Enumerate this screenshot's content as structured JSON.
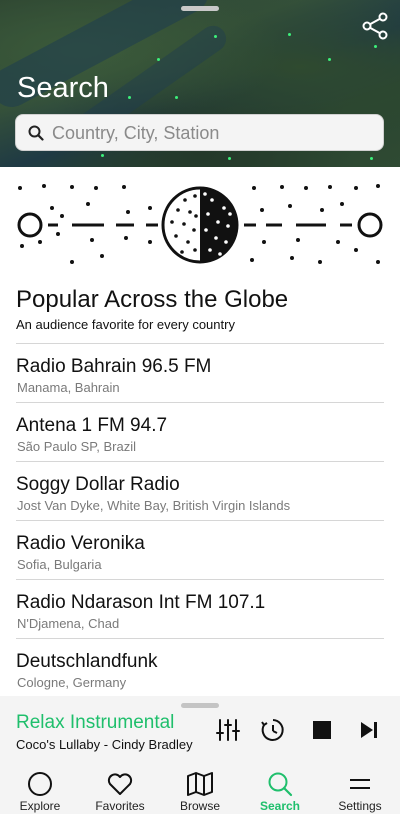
{
  "header": {
    "title": "Search",
    "search_placeholder": "Country, City, Station"
  },
  "section": {
    "title": "Popular Across the Globe",
    "subtitle": "An audience favorite for every country"
  },
  "stations": [
    {
      "name": "Radio Bahrain 96.5 FM",
      "location": "Manama, Bahrain"
    },
    {
      "name": "Antena 1 FM 94.7",
      "location": "São Paulo SP, Brazil"
    },
    {
      "name": "Soggy Dollar Radio",
      "location": "Jost Van Dyke, White Bay, British Virgin Islands"
    },
    {
      "name": "Radio Veronika",
      "location": "Sofia, Bulgaria"
    },
    {
      "name": "Radio Ndarason Int FM 107.1",
      "location": "N'Djamena, Chad"
    },
    {
      "name": "Deutschlandfunk",
      "location": "Cologne, Germany"
    }
  ],
  "player": {
    "title": "Relax Instrumental",
    "subtitle": "Coco's Lullaby - Cindy Bradley"
  },
  "tabs": [
    {
      "label": "Explore",
      "icon": "explore-icon"
    },
    {
      "label": "Favorites",
      "icon": "heart-icon"
    },
    {
      "label": "Browse",
      "icon": "map-icon"
    },
    {
      "label": "Search",
      "icon": "search-icon"
    },
    {
      "label": "Settings",
      "icon": "settings-icon"
    }
  ],
  "colors": {
    "accent": "#1fbf6c",
    "satellite": "#2d4431"
  }
}
